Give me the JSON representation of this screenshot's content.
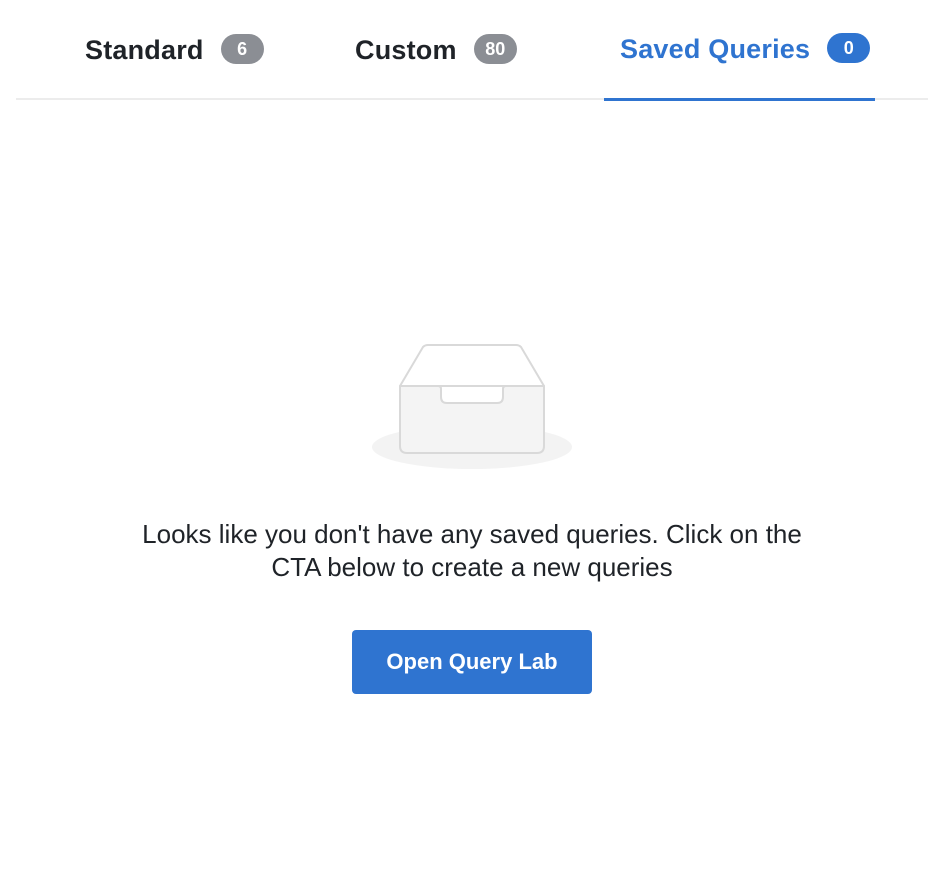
{
  "tabs": [
    {
      "label": "Standard",
      "count": "6",
      "active": false
    },
    {
      "label": "Custom",
      "count": "80",
      "active": false
    },
    {
      "label": "Saved Queries",
      "count": "0",
      "active": true
    }
  ],
  "empty_state": {
    "icon": "empty-inbox-tray-icon",
    "message": "Looks like you don't have any saved queries. Click on the CTA below to create a new queries",
    "cta_label": "Open Query Lab"
  },
  "colors": {
    "accent": "#2f74d0",
    "inactive_badge": "#8b8e94",
    "divider": "#ececec",
    "text": "#1f2328",
    "illustration_fill": "#f3f3f3",
    "illustration_stroke": "#d9d9d9"
  }
}
